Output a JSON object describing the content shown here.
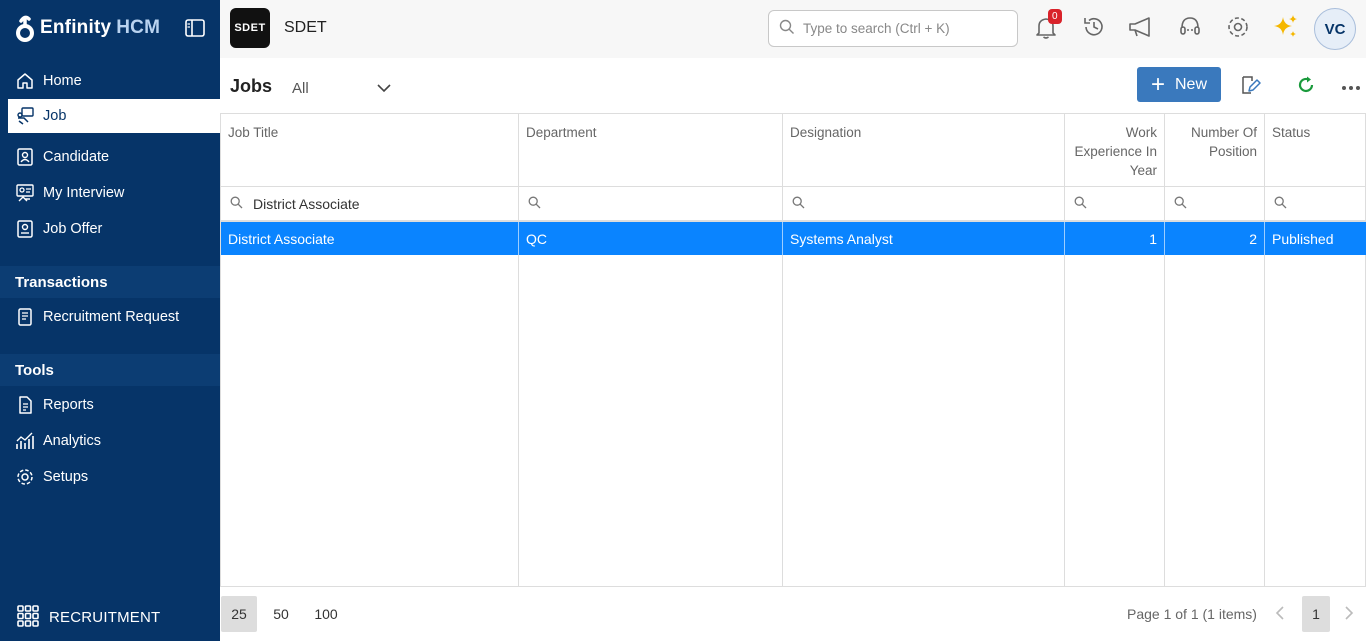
{
  "brand": {
    "name": "Enfinity",
    "suffix": "HCM"
  },
  "sidebar": {
    "items": [
      {
        "label": "Home",
        "icon": "home-icon"
      },
      {
        "label": "Job",
        "icon": "job-icon",
        "active": true
      },
      {
        "label": "Candidate",
        "icon": "candidate-icon"
      },
      {
        "label": "My Interview",
        "icon": "interview-icon"
      },
      {
        "label": "Job Offer",
        "icon": "job-offer-icon"
      }
    ],
    "sections": [
      {
        "title": "Transactions",
        "items": [
          {
            "label": "Recruitment Request",
            "icon": "document-icon"
          }
        ]
      },
      {
        "title": "Tools",
        "items": [
          {
            "label": "Reports",
            "icon": "reports-icon"
          },
          {
            "label": "Analytics",
            "icon": "analytics-icon"
          },
          {
            "label": "Setups",
            "icon": "gear-icon"
          }
        ]
      }
    ],
    "footer": {
      "label": "RECRUITMENT",
      "icon": "app-grid-icon"
    }
  },
  "topbar": {
    "org_badge": "SDET",
    "org_name": "SDET",
    "search_placeholder": "Type to search (Ctrl + K)",
    "notification_count": "0",
    "avatar_initials": "VC"
  },
  "toolbar": {
    "title": "Jobs",
    "view": "All",
    "new_label": "New"
  },
  "grid": {
    "columns": [
      {
        "key": "job_title",
        "label": "Job Title"
      },
      {
        "key": "department",
        "label": "Department"
      },
      {
        "key": "designation",
        "label": "Designation"
      },
      {
        "key": "work_experience",
        "label": "Work Experience In Year"
      },
      {
        "key": "positions",
        "label": "Number Of Position"
      },
      {
        "key": "status",
        "label": "Status"
      }
    ],
    "filters": {
      "job_title": "District Associate"
    },
    "rows": [
      {
        "job_title": "District Associate",
        "department": "QC",
        "designation": "Systems Analyst",
        "work_experience": "1",
        "positions": "2",
        "status": "Published"
      }
    ]
  },
  "pager": {
    "sizes": [
      "25",
      "50",
      "100"
    ],
    "selected_size": "25",
    "info": "Page 1 of 1 (1 items)",
    "current_page": "1"
  },
  "colors": {
    "sidebar": "#063468",
    "accent": "#3a79bd",
    "selected_row": "#0a84ff",
    "badge": "#d9222a"
  }
}
